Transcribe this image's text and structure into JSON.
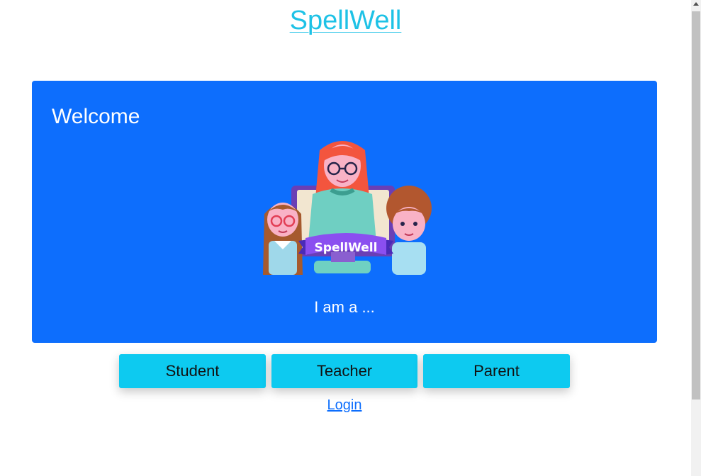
{
  "header": {
    "brand_link": "SpellWell"
  },
  "welcome_card": {
    "title": "Welcome",
    "banner_text": "SpellWell",
    "prompt": "I am a ..."
  },
  "roles": {
    "student_label": "Student",
    "teacher_label": "Teacher",
    "parent_label": "Parent"
  },
  "auth": {
    "login_link": "Login"
  },
  "colors": {
    "brand": "#1ec2e6",
    "card_background": "#0d6efd",
    "role_button": "#0dcaf0",
    "login_link": "#0d6efd"
  }
}
